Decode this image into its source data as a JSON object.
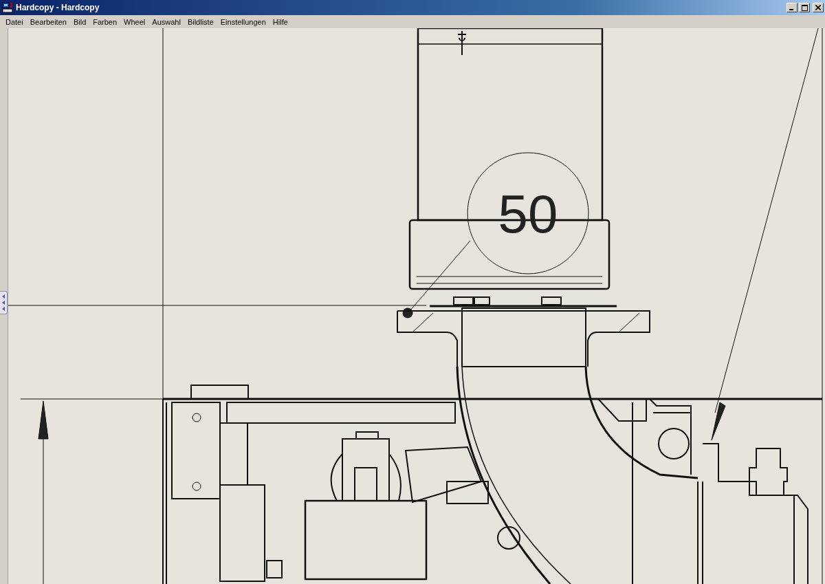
{
  "window": {
    "title": "Hardcopy - Hardcopy"
  },
  "menu": [
    "Datei",
    "Bearbeiten",
    "Bild",
    "Farben",
    "Wheel",
    "Auswahl",
    "Bildliste",
    "Einstellungen",
    "Hilfe"
  ],
  "drawing": {
    "balloon": "50"
  }
}
